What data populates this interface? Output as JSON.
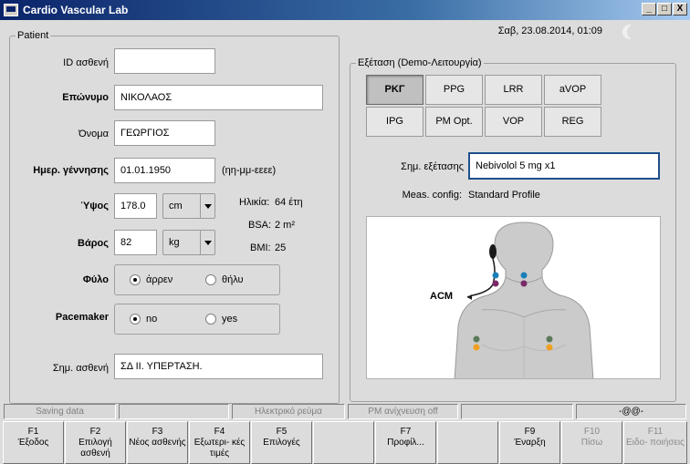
{
  "window": {
    "title": "Cardio Vascular Lab",
    "controls": [
      "_",
      "□",
      "X"
    ]
  },
  "header": {
    "datetime": "Σαβ,  23.08.2014,  01:09"
  },
  "patient": {
    "legend": "Patient",
    "id_label": "ID ασθενή",
    "id_value": "",
    "surname_label": "Επώνυμο",
    "surname_value": "ΝΙΚΟΛΑΟΣ",
    "firstname_label": "Όνομα",
    "firstname_value": "ΓΕΩΡΓΙΟΣ",
    "dob_label": "Ημερ. γέννησης",
    "dob_value": "01.01.1950",
    "dob_hint": "(ηη-μμ-εεεε)",
    "height_label": "Ύψος",
    "height_value": "178.0",
    "height_unit": "cm",
    "weight_label": "Βάρος",
    "weight_value": "82",
    "weight_unit": "kg",
    "age_label": "Ηλικία:",
    "age_value": "64 έτη",
    "bsa_label": "BSA:",
    "bsa_value": "2 m²",
    "bmi_label": "BMI:",
    "bmi_value": "25",
    "sex_label": "Φύλο",
    "sex_male": "άρρεν",
    "sex_female": "θήλυ",
    "sex_selected": "male",
    "pacemaker_label": "Pacemaker",
    "pacemaker_no": "no",
    "pacemaker_yes": "yes",
    "pacemaker_selected": "no",
    "note_label": "Σημ. ασθενή",
    "note_value": "ΣΔ ΙΙ. ΥΠΕΡΤΑΣΗ."
  },
  "exam": {
    "legend": "Εξέταση (Demo-Λειτουργία)",
    "tabs": [
      "ΡΚΓ",
      "PPG",
      "LRR",
      "aVOP",
      "IPG",
      "PM Opt.",
      "VOP",
      "REG"
    ],
    "active_tab": "ΡΚΓ",
    "note_label": "Σημ. εξέτασης",
    "note_value": "Nebivolol 5 mg x1",
    "meas_label": "Meas. config:",
    "meas_value": "Standard Profile",
    "diagram_label": "ACM"
  },
  "status": {
    "items": [
      "Saving data",
      "",
      "Ηλεκτρικό ρεύμα",
      "PM ανίχνευση off",
      "",
      "-@@-"
    ]
  },
  "fkeys": [
    {
      "key": "F1",
      "label": "Έξοδος"
    },
    {
      "key": "F2",
      "label": "Επιλογή ασθενή"
    },
    {
      "key": "F3",
      "label": "Νέος ασθενής"
    },
    {
      "key": "F4",
      "label": "Εξωτερι- κές τιμές"
    },
    {
      "key": "F5",
      "label": "Επιλογές"
    },
    {
      "key": "",
      "label": ""
    },
    {
      "key": "F7",
      "label": "Προφίλ..."
    },
    {
      "key": "",
      "label": ""
    },
    {
      "key": "F9",
      "label": "Έναρξη"
    },
    {
      "key": "F10",
      "label": "Πίσω"
    },
    {
      "key": "F11",
      "label": "Ειδο- ποιήσεις"
    }
  ],
  "colors": {
    "titlebar": "#0a246a",
    "electrode_blue": "#1a7fb8",
    "electrode_purple": "#7a2a6a",
    "electrode_green": "#5a7a5a",
    "electrode_orange": "#f0a020"
  }
}
